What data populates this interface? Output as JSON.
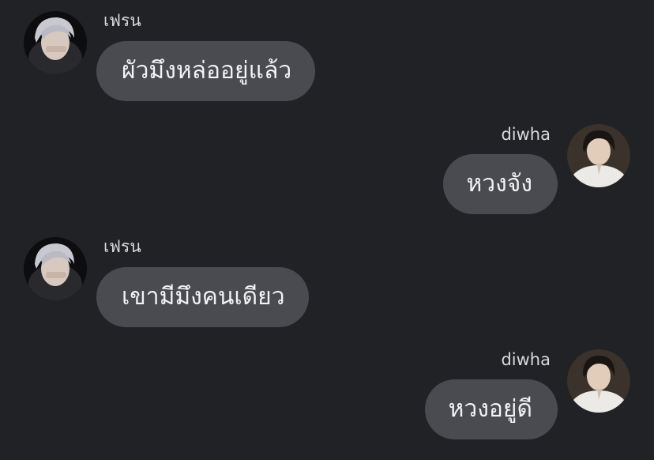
{
  "messages": [
    {
      "side": "left",
      "sender": "เฟรน",
      "text": "ผัวมึงหล่ออยู่แล้ว"
    },
    {
      "side": "right",
      "sender": "diwha",
      "text": "หวงจัง"
    },
    {
      "side": "left",
      "sender": "เฟรน",
      "text": "เขามีมึงคนเดียว"
    },
    {
      "side": "right",
      "sender": "diwha",
      "text": "หวงอยู่ดี"
    }
  ],
  "colors": {
    "background": "#212226",
    "bubble": "#4a4b50",
    "text": "#f2f2f4",
    "name": "#d9d9dc"
  }
}
